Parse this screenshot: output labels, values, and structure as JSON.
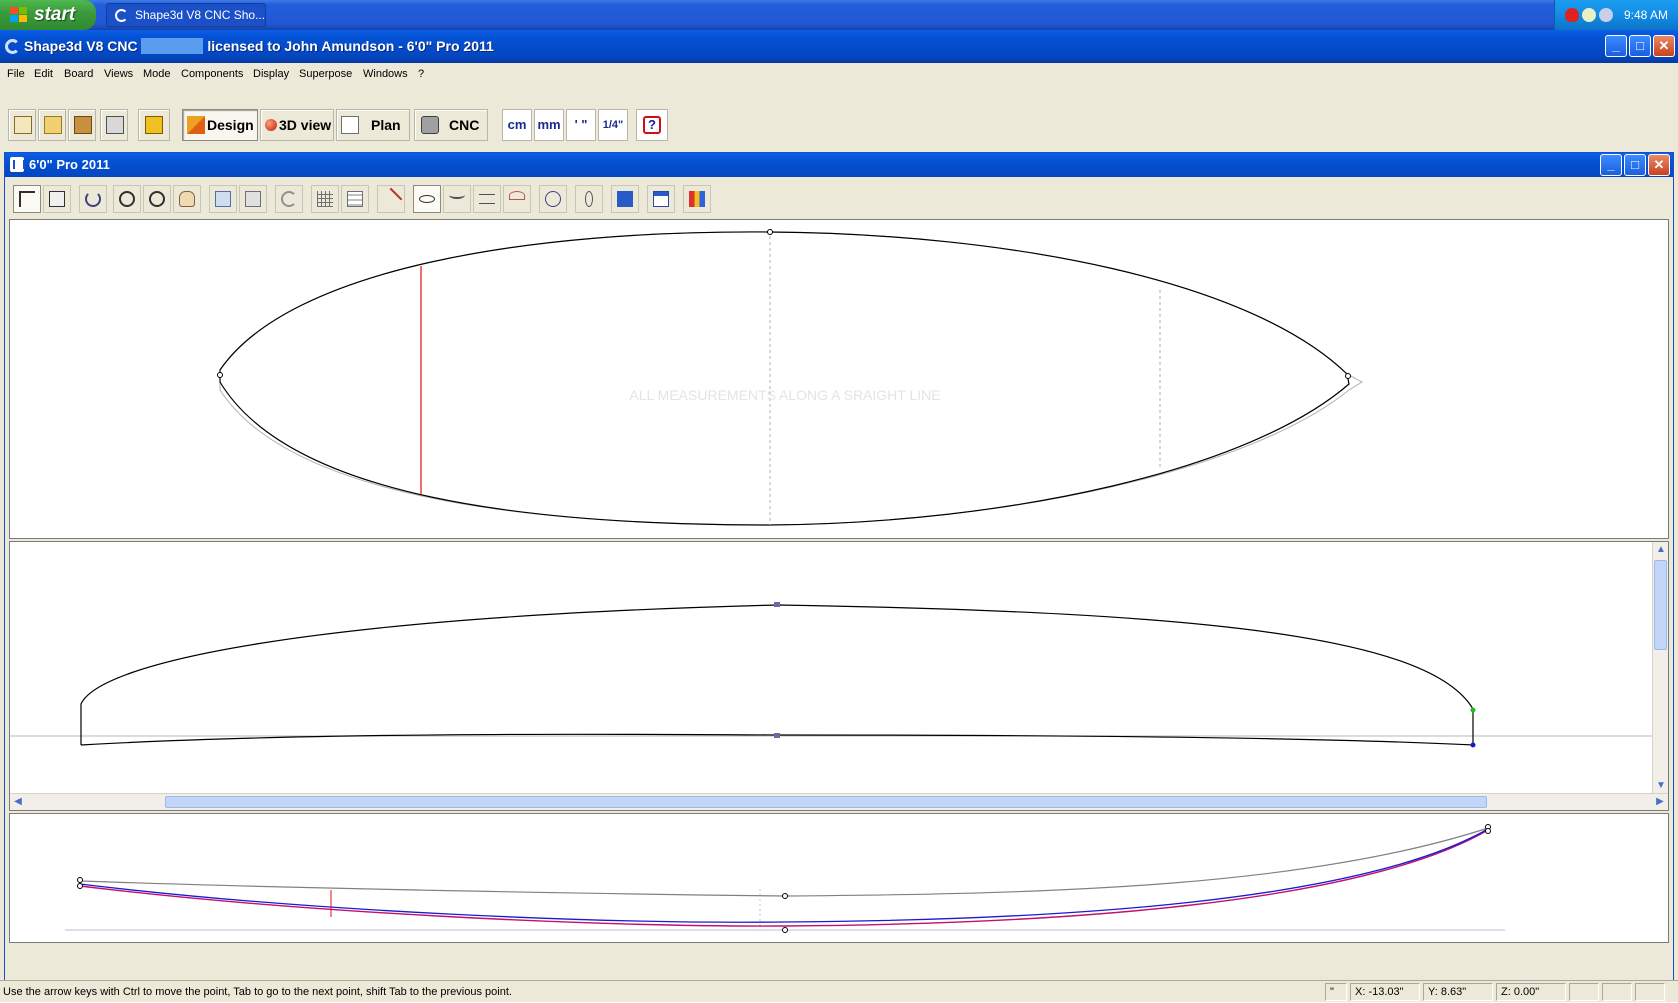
{
  "taskbar": {
    "start_label": "start",
    "task_label": "Shape3d V8 CNC Sho...",
    "clock": "9:48 AM"
  },
  "app": {
    "title_prefix": "Shape3d V8 CNC ",
    "title_suffix": " licensed to John Amundson - 6'0\" Pro 2011"
  },
  "menu": [
    "File",
    "Edit",
    "Board",
    "Views",
    "Mode",
    "Components",
    "Display",
    "Superpose",
    "Windows",
    "?"
  ],
  "toolbar": {
    "design_label": "Design",
    "view3d_label": "3D view",
    "plan_label": "Plan",
    "cnc_label": "CNC",
    "units": [
      "cm",
      "mm",
      "' \"",
      "1/4\""
    ]
  },
  "document": {
    "title": "6'0\" Pro 2011",
    "watermark": "ALL MEASUREMENTS ALONG A SRAIGHT LINE"
  },
  "status": {
    "hint": "Use the arrow keys with Ctrl to move the point, Tab to go to the next point, shift Tab to the previous point.",
    "unit": "\"",
    "x": "X: -13.03\"",
    "y": "Y: 8.63\"",
    "z": "Z: 0.00\""
  },
  "colors": {
    "outline": "#000000",
    "section_marker": "#e01010",
    "rocker_bottom": "#1a1ad0",
    "rocker_deck": "#c01070",
    "guide": "#b0b0b0"
  }
}
